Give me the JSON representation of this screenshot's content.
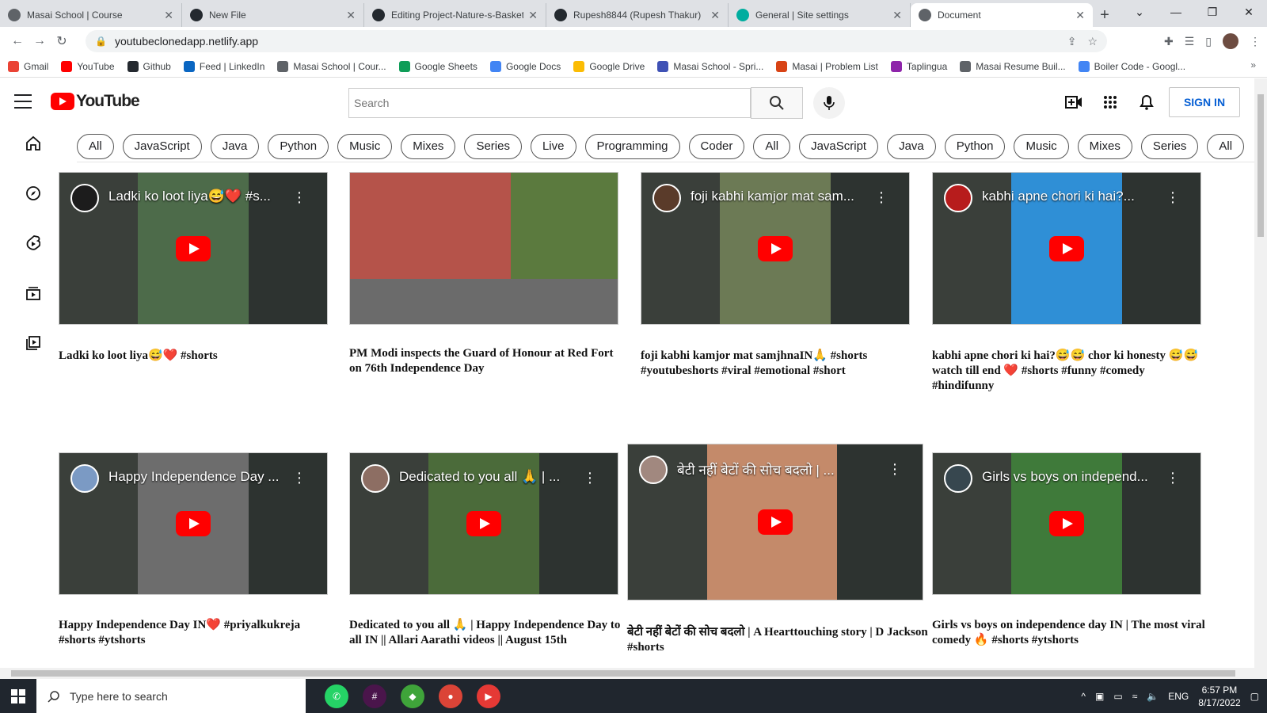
{
  "browser": {
    "tabs": [
      {
        "title": "Masai School | Course",
        "color": "#5f6368"
      },
      {
        "title": "New File",
        "color": "#24292f"
      },
      {
        "title": "Editing Project-Nature-s-Basket",
        "color": "#24292f"
      },
      {
        "title": "Rupesh8844 (Rupesh Thakur)",
        "color": "#24292f"
      },
      {
        "title": "General | Site settings",
        "color": "#00ad9f"
      },
      {
        "title": "Document",
        "color": "#5f6368",
        "active": true
      }
    ],
    "url": "youtubeclonedapp.netlify.app",
    "bookmarks": [
      {
        "label": "Gmail",
        "color": "#ea4335"
      },
      {
        "label": "YouTube",
        "color": "#ff0000"
      },
      {
        "label": "Github",
        "color": "#24292f"
      },
      {
        "label": "Feed | LinkedIn",
        "color": "#0a66c2"
      },
      {
        "label": "Masai School | Cour...",
        "color": "#5f6368"
      },
      {
        "label": "Google Sheets",
        "color": "#0f9d58"
      },
      {
        "label": "Google Docs",
        "color": "#4285f4"
      },
      {
        "label": "Google Drive",
        "color": "#fbbc04"
      },
      {
        "label": "Masai School - Spri...",
        "color": "#3f51b5"
      },
      {
        "label": "Masai | Problem List",
        "color": "#d84315"
      },
      {
        "label": "Taplingua",
        "color": "#8e24aa"
      },
      {
        "label": "Masai Resume Buil...",
        "color": "#5f6368"
      },
      {
        "label": "Boiler Code - Googl...",
        "color": "#4285f4"
      }
    ]
  },
  "youtube": {
    "logo_text": "YouTube",
    "search_placeholder": "Search",
    "signin_label": "SIGN IN",
    "chips": [
      "All",
      "JavaScript",
      "Java",
      "Python",
      "Music",
      "Mixes",
      "Series",
      "Live",
      "Programming",
      "Coder",
      "All",
      "JavaScript",
      "Java",
      "Python",
      "Music",
      "Mixes",
      "Series",
      "All"
    ],
    "videos": [
      {
        "overlay": "Ladki ko loot liya😅❤️ #s...",
        "caption": "Ladki ko loot liya😅❤️ #shorts",
        "center": "#4d6b4a",
        "chan": "#1c1c1c",
        "plain": false
      },
      {
        "overlay": "",
        "caption": "PM Modi inspects the Guard of Honour at Red Fort on 76th Independence Day",
        "center": "#a0524a",
        "chan": "#000",
        "plain": true
      },
      {
        "overlay": "foji kabhi kamjor mat sam...",
        "caption": "foji kabhi kamjor mat samjhnaIN🙏 #shorts #youtubeshorts #viral #emotional #short",
        "center": "#6c7a55",
        "chan": "#5a3b2a",
        "plain": false
      },
      {
        "overlay": "kabhi apne chori ki hai?...",
        "caption": "kabhi apne chori ki hai?😅😅 chor ki honesty 😅😅 watch till end ❤️ #shorts #funny #comedy #hindifunny",
        "center": "#2f8fd6",
        "chan": "#b71c1c",
        "plain": false
      },
      {
        "overlay": "Happy Independence Day ...",
        "caption": "Happy Independence Day IN❤️ #priyalkukreja #shorts #ytshorts",
        "center": "#6d6d6d",
        "chan": "#7b9ac4",
        "plain": false
      },
      {
        "overlay": "Dedicated to you all 🙏 | ...",
        "caption": "Dedicated to you all 🙏 | Happy Independence Day to all IN || Allari Aarathi videos || August 15th",
        "center": "#4b6b3a",
        "chan": "#8d6e63",
        "plain": false
      },
      {
        "overlay": "बेटी नहीं बेटों की सोच बदलो | ...",
        "caption": "बेटी नहीं बेटों की सोच बदलो | A Hearttouching story | D Jackson #shorts",
        "center": "#c48a6a",
        "chan": "#a1887f",
        "plain": false
      },
      {
        "overlay": "Girls vs boys on independ...",
        "caption": "Girls vs boys on independence day IN | The most viral comedy 🔥 #shorts #ytshorts",
        "center": "#3f7a3a",
        "chan": "#37474f",
        "plain": false
      }
    ]
  },
  "taskbar": {
    "search_placeholder": "Type here to search",
    "lang": "ENG",
    "time": "6:57 PM",
    "date": "8/17/2022"
  }
}
